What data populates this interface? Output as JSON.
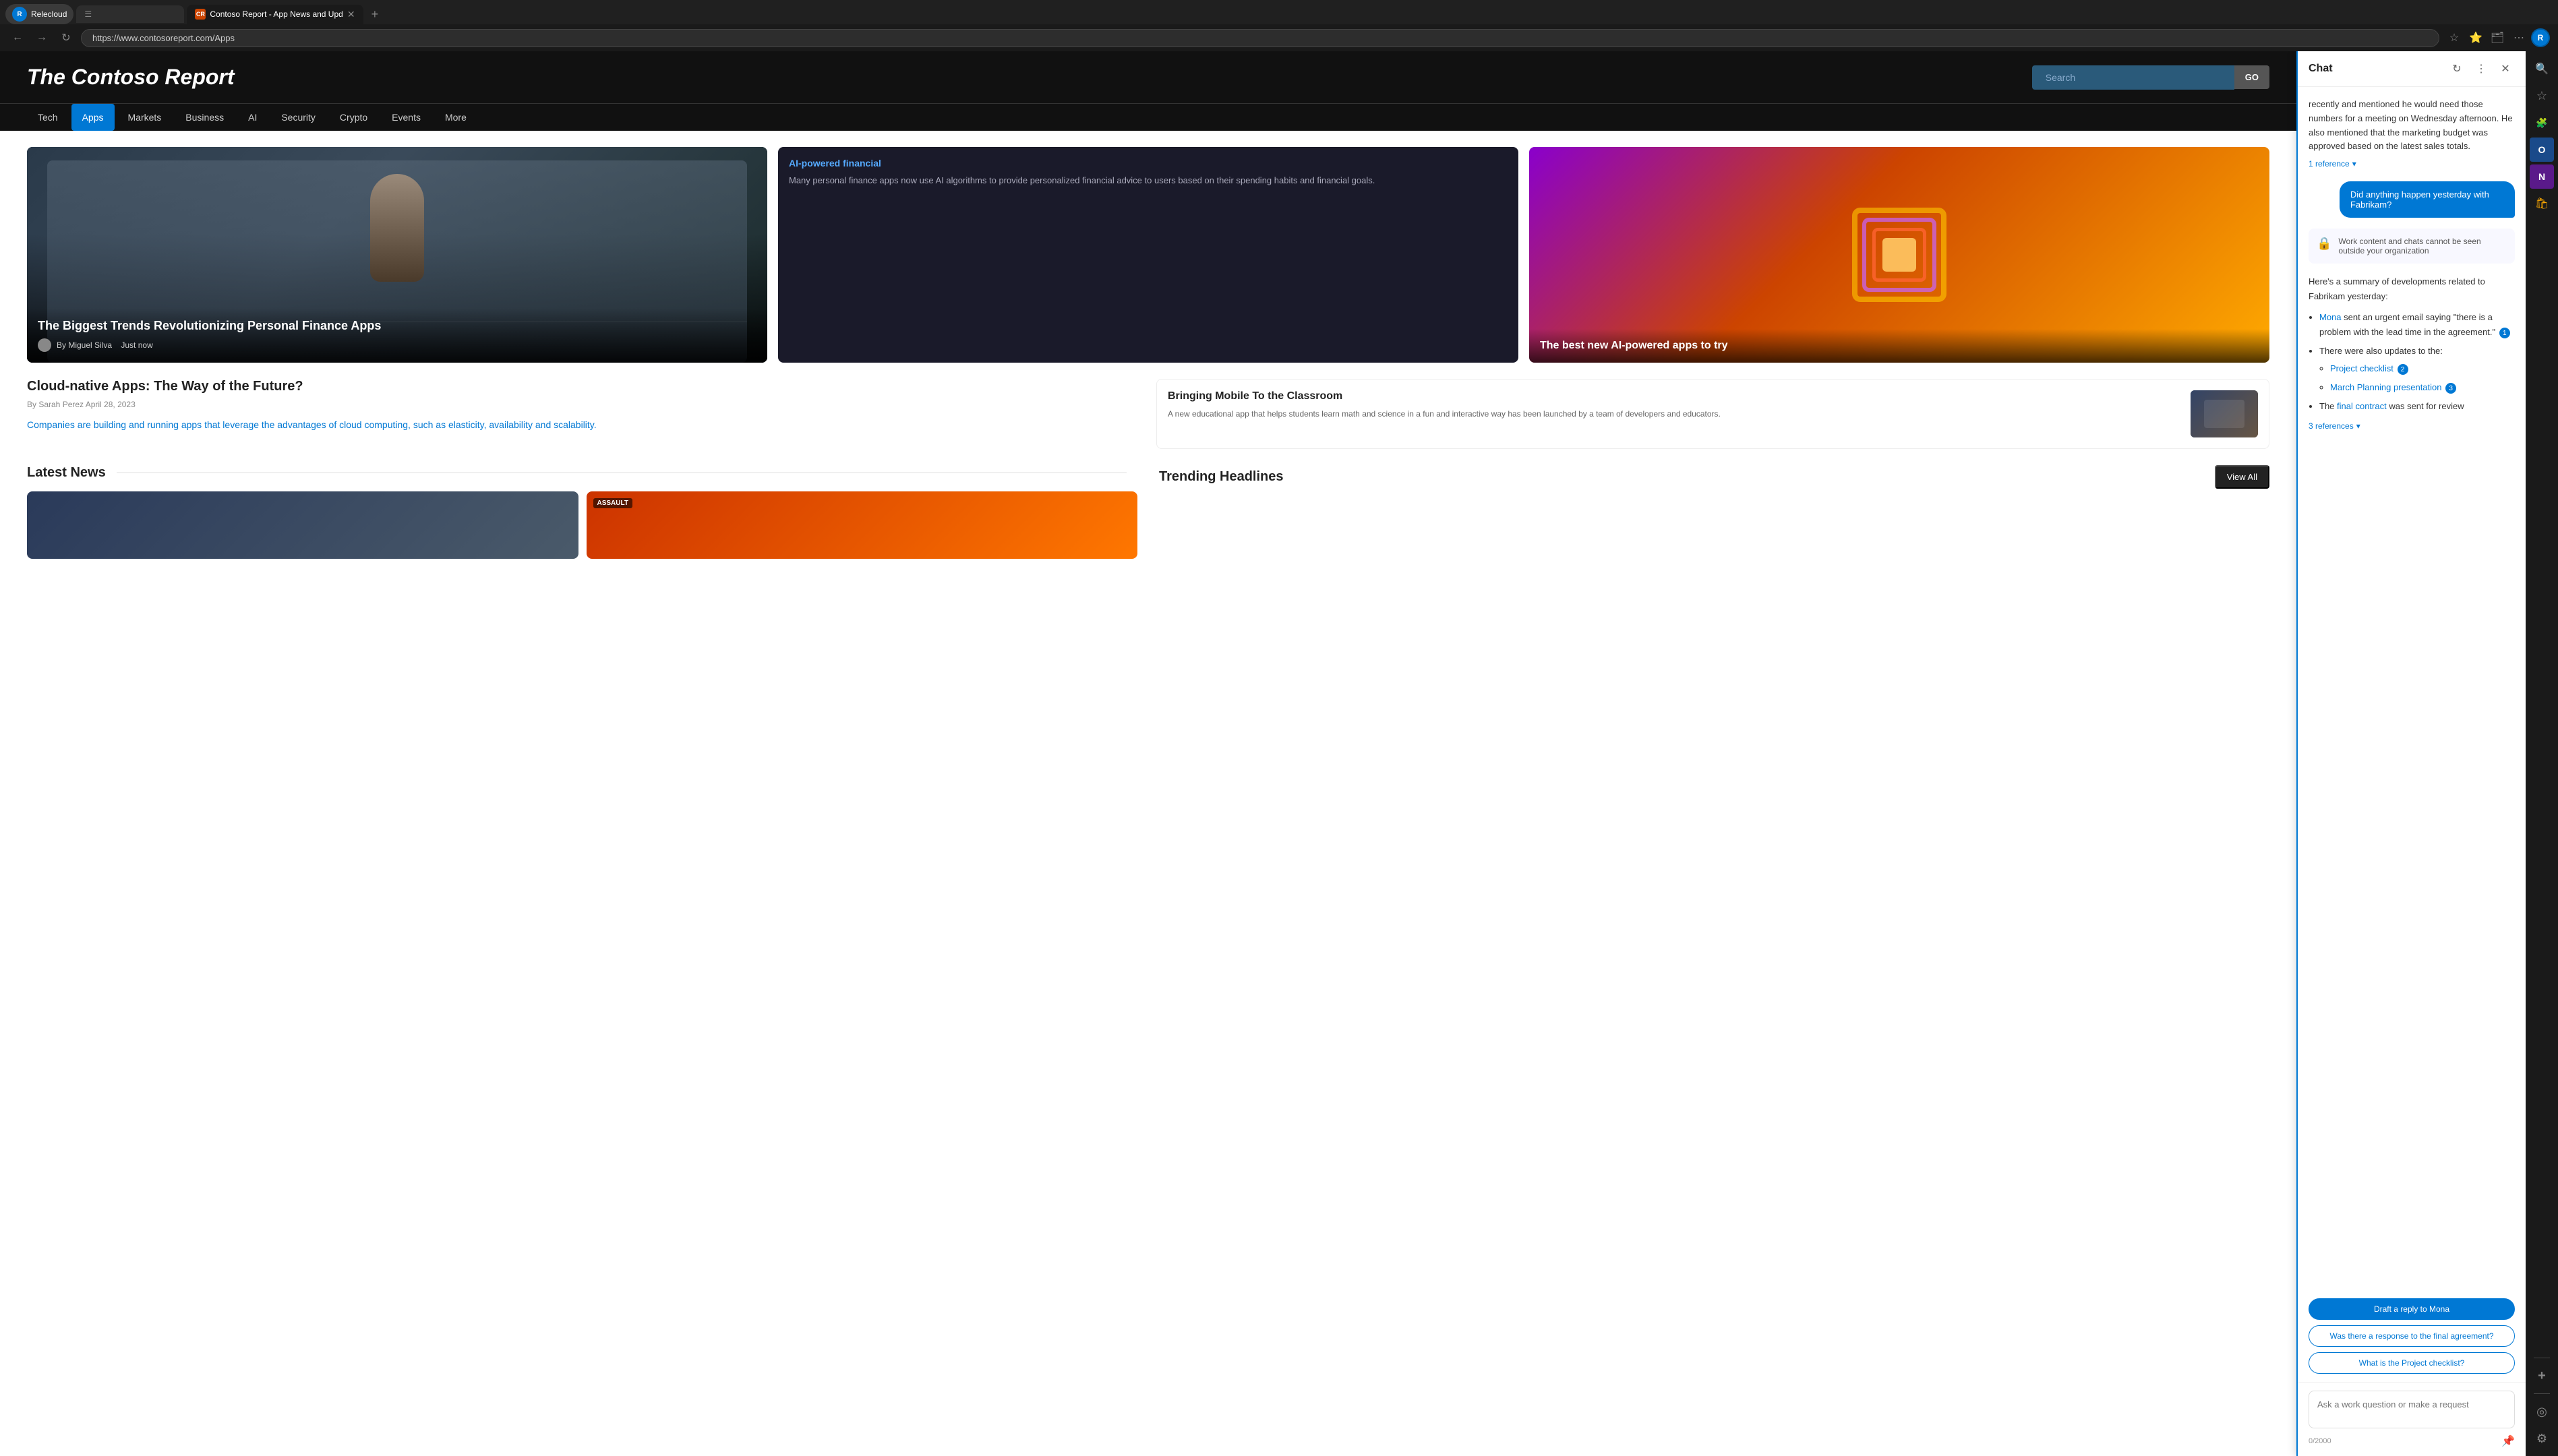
{
  "browser": {
    "profile": {
      "name": "Relecloud",
      "initials": "R"
    },
    "tabs": [
      {
        "id": "tab1",
        "label": "Contoso Report - App News and Upd",
        "favicon": "CR",
        "active": true
      },
      {
        "id": "tab2",
        "label": "",
        "favicon": "",
        "active": false
      }
    ],
    "address": "https://www.contosoreport.com/Apps",
    "nav": {
      "back": "←",
      "forward": "→",
      "refresh": "↻",
      "home": "⌂"
    }
  },
  "site": {
    "logo": "The Contoso Report",
    "search": {
      "placeholder": "Search",
      "button": "GO"
    },
    "nav": [
      {
        "label": "Tech",
        "active": false
      },
      {
        "label": "Apps",
        "active": true
      },
      {
        "label": "Markets",
        "active": false
      },
      {
        "label": "Business",
        "active": false
      },
      {
        "label": "AI",
        "active": false
      },
      {
        "label": "Security",
        "active": false
      },
      {
        "label": "Crypto",
        "active": false
      },
      {
        "label": "Events",
        "active": false
      },
      {
        "label": "More",
        "active": false
      }
    ],
    "featured": {
      "main": {
        "title": "The Biggest Trends Revolutionizing Personal Finance Apps",
        "author": "By Miguel Silva",
        "time": "Just now"
      },
      "mid": {
        "title": "AI-powered financial",
        "body": "Many personal finance apps now use AI algorithms to provide personalized financial advice to users based on their spending habits and financial goals."
      },
      "right": {
        "title": "The best new AI-powered apps to try"
      }
    },
    "article": {
      "title": "Cloud-native Apps: The Way of the Future?",
      "meta": "By Sarah Perez   April 28, 2023",
      "body": "Companies are building and running apps that leverage the advantages of cloud computing, such as elasticity, availability and scalability."
    },
    "news_article": {
      "title": "Bringing Mobile To the Classroom",
      "body": "A new educational app that helps students learn math and science in a fun and interactive way has been launched by a team of developers and educators."
    },
    "bottom": {
      "latest_news": "Latest News",
      "trending": "Trending Headlines",
      "view_all": "View All"
    }
  },
  "chat": {
    "title": "Chat",
    "header_icons": {
      "refresh": "↻",
      "more": "⋮",
      "close": "✕"
    },
    "messages": [
      {
        "type": "assistant",
        "text": "recently and mentioned he would need those numbers for a meeting on Wednesday afternoon. He also mentioned that the marketing budget was approved based on the latest sales totals.",
        "ref_count": "1",
        "reference_label": "1 reference"
      },
      {
        "type": "user",
        "text": "Did anything happen yesterday with Fabrikam?"
      },
      {
        "type": "security_notice",
        "text": "Work content and chats cannot be seen outside your organization"
      },
      {
        "type": "assistant_summary",
        "intro": "Here's a summary of developments related to Fabrikam yesterday:",
        "bullets": [
          {
            "text": " sent an urgent email saying \"there is a problem with the lead time in the agreement.\"",
            "link": "Mona",
            "ref": "1"
          },
          {
            "text": "There were also updates to the:",
            "sub": [
              {
                "label": "Project checklist",
                "ref": "2"
              },
              {
                "label": "March Planning presentation",
                "ref": "3"
              }
            ]
          },
          {
            "text": "The ",
            "link": "final contract",
            "suffix": " was sent for review"
          }
        ],
        "reference_label": "3 references"
      }
    ],
    "suggestions": [
      {
        "label": "Draft a reply to Mona",
        "primary": true
      },
      {
        "label": "Was there a response to the final agreement?"
      },
      {
        "label": "What is the Project checklist?"
      }
    ],
    "input": {
      "placeholder": "Ask a work question or make a request",
      "char_count": "0/2000"
    }
  },
  "edge_toolbar": {
    "icons": [
      {
        "name": "search-icon",
        "symbol": "🔍",
        "color": "default"
      },
      {
        "name": "favorites-icon",
        "symbol": "☆",
        "color": "default"
      },
      {
        "name": "extensions-icon",
        "symbol": "🧩",
        "color": "red"
      },
      {
        "name": "outlook-icon",
        "symbol": "O",
        "color": "blue"
      },
      {
        "name": "onenote-icon",
        "symbol": "N",
        "color": "purple"
      },
      {
        "name": "shopping-icon",
        "symbol": "🛍",
        "color": "yellow"
      },
      {
        "name": "add-icon",
        "symbol": "+",
        "color": "default"
      },
      {
        "name": "copilot-icon",
        "symbol": "◎",
        "color": "default"
      },
      {
        "name": "settings-icon",
        "symbol": "⚙",
        "color": "default"
      }
    ]
  }
}
